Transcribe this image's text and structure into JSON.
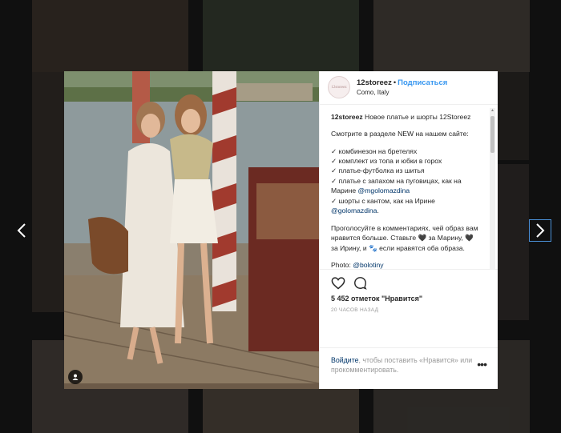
{
  "post": {
    "username": "12storeez",
    "follow_label": "Подписаться",
    "location": "Como, Italy",
    "avatar_text": "12storeez",
    "caption_user": "12storeez",
    "caption_p1": "Новое платье и шорты 12Storeez",
    "caption_p2": "Смотрите в разделе NEW на нашем сайте:",
    "caption_list": [
      {
        "text": "✓ комбинезон на бретелях"
      },
      {
        "text": "✓ комплект из топа и юбки в горох"
      },
      {
        "text": "✓ платье-футболка из шитья"
      },
      {
        "text": "✓ платье с запахом на пуговицах, как на Марине ",
        "mention": "@mgolomazdina"
      },
      {
        "text": "✓ шорты с кантом, как на Ирине ",
        "mention": "@golomazdina",
        "suffix": "."
      }
    ],
    "caption_p3": "Проголосуйте в комментариях, чей образ вам нравится больше. Ставьте 🖤 за Марину, 🖤 за Ирину, и 🐾 если нравятся оба образа.",
    "caption_p4_label": "Photo: ",
    "caption_p4_mention": "@bolotiny",
    "likes": "5 452 отметок \"Нравится\"",
    "time_ago": "20 ЧАСОВ НАЗАД",
    "login_prompt": {
      "link1": "Войдите",
      "middle": ", чтобы поставить «Нравится» или прокомментировать."
    },
    "more_icon": "•••"
  },
  "icons": {
    "heart": "heart-icon",
    "comment": "comment-icon",
    "prev": "chevron-left-icon",
    "next": "chevron-right-icon",
    "tag": "user-tag-icon",
    "more": "more-options-icon"
  },
  "colors": {
    "accent": "#3897f0",
    "mention": "#003569",
    "text": "#262626",
    "muted": "#999999"
  }
}
